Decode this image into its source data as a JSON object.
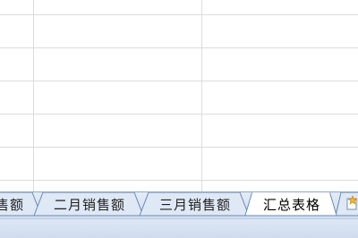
{
  "sheet_tabs": [
    {
      "label": "售额",
      "active": false
    },
    {
      "label": "二月销售额",
      "active": false
    },
    {
      "label": "三月销售额",
      "active": false
    },
    {
      "label": "汇总表格",
      "active": true
    }
  ],
  "icons": {
    "insert_sheet": "insert-sheet-icon"
  },
  "colors": {
    "grid_line": "#dadcdd",
    "tab_bar_bg": "#d6e2f2",
    "active_tab_bg": "#ffffff",
    "tab_border": "#6a87b0"
  }
}
